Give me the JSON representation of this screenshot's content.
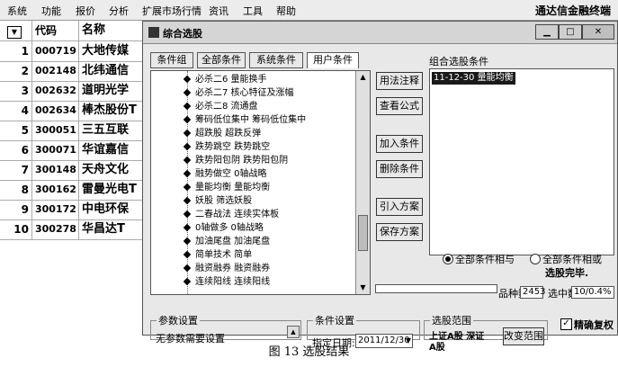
{
  "menubar": {
    "items": [
      "系统",
      "功能",
      "报价",
      "分析",
      "扩展市场行情",
      "资讯",
      "工具",
      "帮助"
    ],
    "brand": "通达信金融终端"
  },
  "stocklist": {
    "toggle": "▼",
    "header": {
      "code": "代码",
      "name": "名称"
    },
    "rows": [
      {
        "idx": "1",
        "code": "000719",
        "name": "大地传媒"
      },
      {
        "idx": "2",
        "code": "002148",
        "name": "北纬通信"
      },
      {
        "idx": "3",
        "code": "002632",
        "name": "道明光学"
      },
      {
        "idx": "4",
        "code": "002634",
        "name": "棒杰股份T"
      },
      {
        "idx": "5",
        "code": "300051",
        "name": "三五互联"
      },
      {
        "idx": "6",
        "code": "300071",
        "name": "华谊嘉信"
      },
      {
        "idx": "7",
        "code": "300148",
        "name": "天舟文化"
      },
      {
        "idx": "8",
        "code": "300162",
        "name": "雷曼光电T"
      },
      {
        "idx": "9",
        "code": "300172",
        "name": "中电环保"
      },
      {
        "idx": "10",
        "code": "300278",
        "name": "华昌达T"
      }
    ]
  },
  "dialog": {
    "title": "综合选股",
    "tabs": [
      "条件组",
      "全部条件",
      "系统条件",
      "用户条件"
    ],
    "tree_items": [
      "必杀二6 量能换手",
      "必杀二7 核心特征及涨幅",
      "必杀二8 流通盘",
      "筹码低位集中 筹码低位集中",
      "超跌股 超跌反弹",
      "跌势跳空 跌势跳空",
      "跌势阳包阴 跌势阳包阴",
      "融势做空 0轴战略",
      "量能均衡 量能均衡",
      "妖股 筛选妖股",
      "二春战法 连续实体板",
      "0轴做多 0轴战略",
      "加油尾盘 加油尾盘",
      "简单技术 简单",
      "融资融券 融资融券",
      "连续阳线 连续阳线"
    ],
    "buttons": {
      "usage": "用法注释",
      "view_formula": "查看公式",
      "add": "加入条件",
      "delete": "删除条件",
      "import": "引入方案",
      "save": "保存方案",
      "change_range": "改变范围"
    },
    "combined_label": "组合选股条件",
    "combined_items": [
      "11-12-30 量能均衡"
    ],
    "radio_and": "全部条件相与",
    "radio_or": "全部条件相或",
    "status_done": "选股完毕.",
    "count_label": "品种数",
    "count_value": "2453",
    "selected_label": "选中数",
    "selected_value": "10/0.4%",
    "param_group": "参数设置",
    "param_text": "无参数需要设置",
    "cond_group": "条件设置",
    "date_label": "指定日期:",
    "date_value": "2011/12/30",
    "range_group": "选股范围",
    "range_line1": "上证A股 深证",
    "range_line2": "A股",
    "precise_label": "精确复权",
    "precise_check": "✓"
  },
  "caption": "图 13  选股结果"
}
